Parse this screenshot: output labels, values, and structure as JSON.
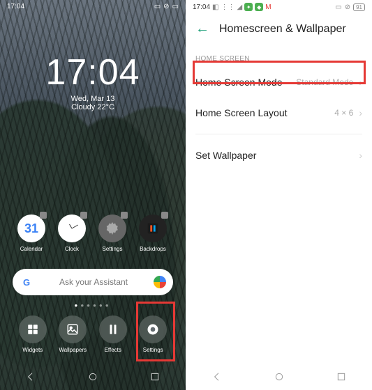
{
  "left": {
    "status": {
      "time": "17:04"
    },
    "clock": {
      "time": "17:04",
      "date": "Wed, Mar 13",
      "weather": "Cloudy 22°C"
    },
    "apps": [
      {
        "name": "Calendar",
        "day": "31"
      },
      {
        "name": "Clock"
      },
      {
        "name": "Settings"
      },
      {
        "name": "Backdrops"
      }
    ],
    "search": {
      "placeholder": "Ask your Assistant"
    },
    "dock": [
      {
        "name": "Widgets"
      },
      {
        "name": "Wallpapers"
      },
      {
        "name": "Effects"
      },
      {
        "name": "Settings"
      }
    ]
  },
  "right": {
    "status": {
      "time": "17:04",
      "battery": "91"
    },
    "title": "Homescreen & Wallpaper",
    "section": "HOME SCREEN",
    "rows": [
      {
        "label": "Home Screen Mode",
        "value": "Standard Mode"
      },
      {
        "label": "Home Screen Layout",
        "value": "4 × 6"
      },
      {
        "label": "Set Wallpaper",
        "value": ""
      }
    ]
  }
}
